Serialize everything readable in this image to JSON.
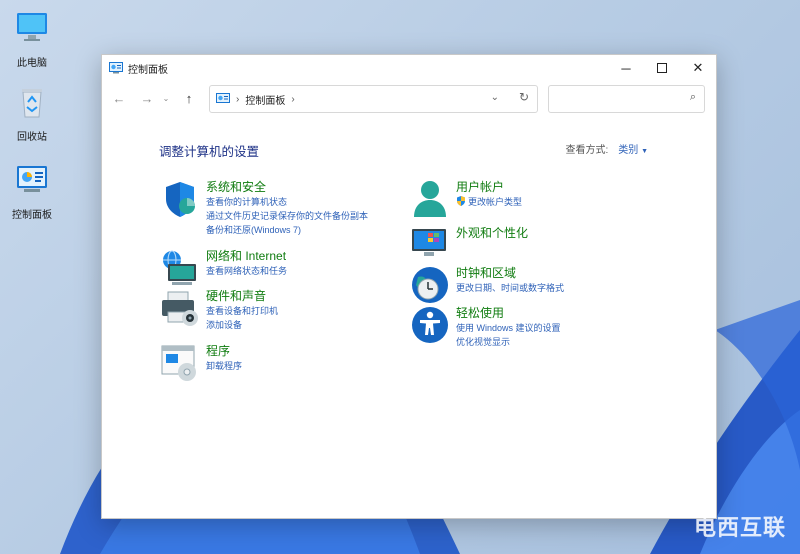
{
  "desktop": {
    "icons": [
      {
        "label": "此电脑"
      },
      {
        "label": "回收站"
      },
      {
        "label": "控制面板"
      }
    ]
  },
  "window": {
    "title": "控制面板",
    "breadcrumb": "控制面板",
    "search_placeholder": "",
    "heading": "调整计算机的设置",
    "view_by_label": "查看方式:",
    "view_by_value": "类别"
  },
  "categories": [
    {
      "title": "系统和安全",
      "links": [
        "查看你的计算机状态",
        "通过文件历史记录保存你的文件备份副本",
        "备份和还原(Windows 7)"
      ]
    },
    {
      "title": "网络和 Internet",
      "links": [
        "查看网络状态和任务"
      ]
    },
    {
      "title": "硬件和声音",
      "links": [
        "查看设备和打印机",
        "添加设备"
      ]
    },
    {
      "title": "程序",
      "links": [
        "卸载程序"
      ]
    },
    {
      "title": "用户帐户",
      "links": [
        "更改帐户类型"
      ]
    },
    {
      "title": "外观和个性化",
      "links": []
    },
    {
      "title": "时钟和区域",
      "links": [
        "更改日期、时间或数字格式"
      ]
    },
    {
      "title": "轻松使用",
      "links": [
        "使用 Windows 建议的设置",
        "优化视觉显示"
      ]
    }
  ],
  "watermark": "电西互联",
  "colors": {
    "accent": "#2f62b8",
    "category_title": "#107c10",
    "heading": "#1e3287"
  }
}
